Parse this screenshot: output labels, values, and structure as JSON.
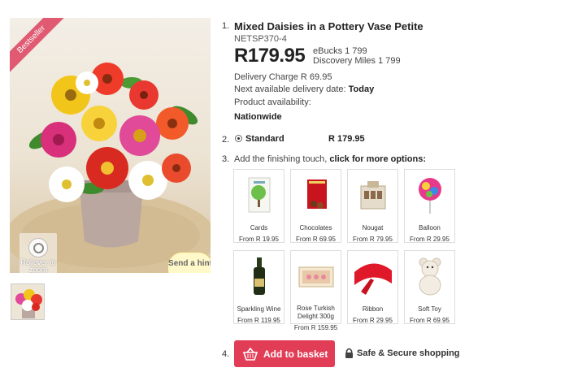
{
  "product": {
    "badge": "Bestseller",
    "zoom_hint": "Rollover to zoom",
    "send_hint": "Send a hint",
    "title": "Mixed Daisies in a Pottery Vase Petite",
    "sku": "NETSP370-4",
    "price": "R179.95",
    "ebucks": "eBucks 1 799",
    "discovery_miles": "Discovery Miles 1 799",
    "delivery_charge": "Delivery Charge R 69.95",
    "next_delivery_label": "Next available delivery date:",
    "next_delivery_value": "Today",
    "availability_label": "Product availability:",
    "availability_value": "Nationwide"
  },
  "steps": {
    "s1": "1.",
    "s2": "2.",
    "s3": "3.",
    "s4": "4."
  },
  "size_option": {
    "label": "Standard",
    "price": "R 179.95",
    "selected": true
  },
  "finishing": {
    "prefix": "Add the finishing touch,",
    "cta": "click for more options:",
    "items": [
      {
        "name": "Cards",
        "price": "From R 19.95",
        "icon": "card-icon"
      },
      {
        "name": "Chocolates",
        "price": "From R 69.95",
        "icon": "chocolates-icon"
      },
      {
        "name": "Nougat",
        "price": "From R 79.95",
        "icon": "nougat-icon"
      },
      {
        "name": "Balloon",
        "price": "From R 29.95",
        "icon": "balloon-icon"
      },
      {
        "name": "Sparkling Wine",
        "price": "From R 119.95",
        "icon": "wine-icon"
      },
      {
        "name": "Rose Turkish Delight 300g",
        "price": "From R 159.95",
        "icon": "turkish-delight-icon"
      },
      {
        "name": "Ribbon",
        "price": "From R 29.95",
        "icon": "ribbon-icon"
      },
      {
        "name": "Soft Toy",
        "price": "From R 69.95",
        "icon": "teddy-icon"
      }
    ]
  },
  "actions": {
    "add_to_basket": "Add to basket",
    "secure": "Safe & Secure shopping"
  },
  "colors": {
    "accent": "#e23d56",
    "badge": "#e05a72"
  }
}
